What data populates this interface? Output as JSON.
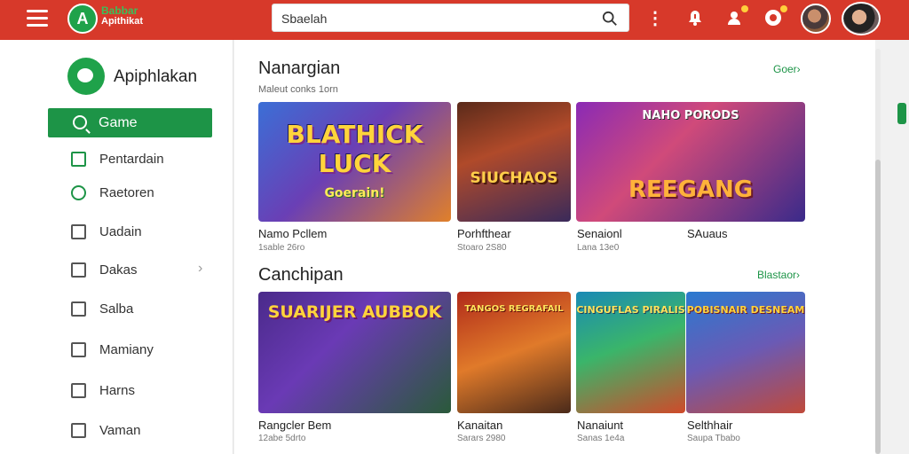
{
  "header": {
    "brand_top": "Babbar",
    "brand_bottom": "Apithikat",
    "search_value": "Sbaelah"
  },
  "sidebar": {
    "title": "Apiphlakan",
    "items": [
      {
        "label": "Game"
      },
      {
        "label": "Pentardain"
      },
      {
        "label": "Raetoren"
      },
      {
        "label": "Uadain"
      },
      {
        "label": "Dakas"
      },
      {
        "label": "Salba"
      },
      {
        "label": "Mamiany"
      },
      {
        "label": "Harns"
      },
      {
        "label": "Vaman"
      }
    ]
  },
  "sections": [
    {
      "title": "Nanargian",
      "subtitle": "Maleut conks 1orn",
      "link": "Goer›",
      "cards": [
        {
          "art": "BLATHICK LUCK",
          "art2": "Goerain!",
          "name": "Namo Pcllem",
          "meta": "1sable 26ro"
        },
        {
          "art": "SIUCHAOS",
          "name": "Porhfthear",
          "meta": "Stoaro 2S80"
        },
        {
          "art": "REEGANG",
          "art2": "NAHO PORODS",
          "name": "Senaionl",
          "meta": "Lana 13e0"
        },
        {
          "name": "SAuaus"
        }
      ]
    },
    {
      "title": "Canchipan",
      "link": "Blastaor›",
      "cards": [
        {
          "art": "SUARIJER AUBBOK",
          "name": "Rangcler Bem",
          "meta": "12abe 5drto"
        },
        {
          "art": "TANGOS REGRAFAIL",
          "name": "Kanaitan",
          "meta": "Sarars 2980"
        },
        {
          "art": "CINGUFLAS PIRALIS",
          "name": "Nanaiunt",
          "meta": "Sanas 1e4a"
        },
        {
          "art": "POBISNAIR DESNEAM",
          "name": "Selthhair",
          "meta": "Saupa Tbabo"
        }
      ]
    }
  ]
}
